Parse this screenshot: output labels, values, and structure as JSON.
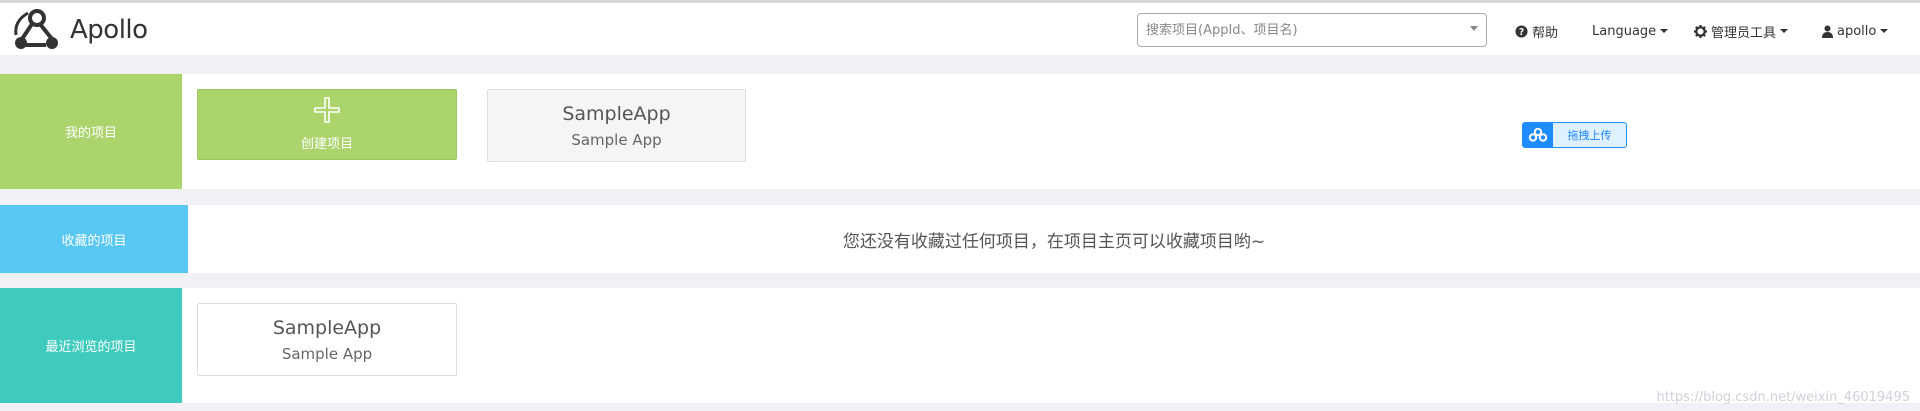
{
  "brand": {
    "name": "Apollo",
    "logo_icon": "apollo-logo-icon"
  },
  "search": {
    "placeholder": "搜索项目(AppId、项目名)",
    "value": ""
  },
  "nav": {
    "help": {
      "label": "帮助",
      "icon": "question-circle-icon"
    },
    "language": {
      "label": "Language"
    },
    "admin_tools": {
      "label": "管理员工具",
      "icon": "gear-icon"
    },
    "user": {
      "label": "apollo",
      "icon": "user-icon"
    }
  },
  "colors": {
    "my_projects": "#abd46c",
    "favorites": "#58c8f2",
    "recent": "#3ecbbd",
    "background": "#f1f1f5"
  },
  "sections": {
    "my_projects": {
      "label": "我的项目",
      "create_label": "创建项目",
      "apps": [
        {
          "app_id": "SampleApp",
          "name": "Sample App"
        }
      ]
    },
    "favorites": {
      "label": "收藏的项目",
      "empty_message": "您还没有收藏过任何项目，在项目主页可以收藏项目哟~"
    },
    "recent": {
      "label": "最近浏览的项目",
      "apps": [
        {
          "app_id": "SampleApp",
          "name": "Sample App"
        }
      ]
    }
  },
  "upload_badge": {
    "label": "拖拽上传",
    "icon": "baidu-cloud-icon"
  },
  "watermark": "https://blog.csdn.net/weixin_46019495"
}
